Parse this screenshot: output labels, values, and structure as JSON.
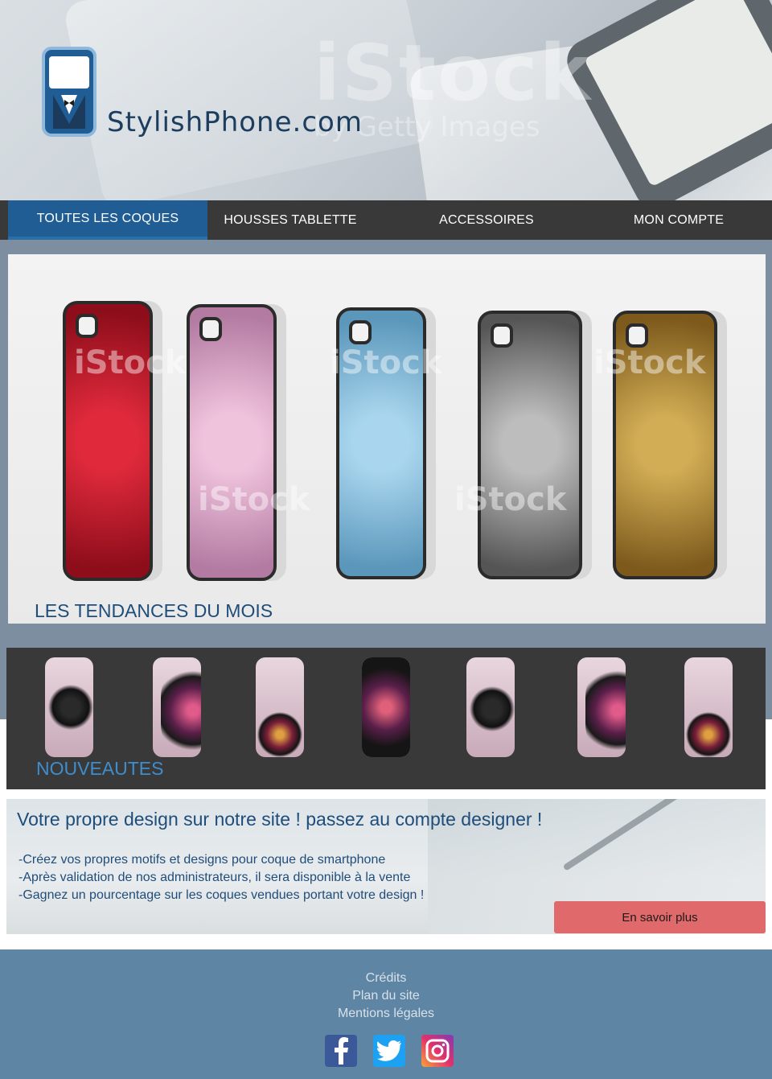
{
  "brand": {
    "name": "StylishPhone.com"
  },
  "header": {
    "watermark": "iStock",
    "watermark_sub": "by Getty Images"
  },
  "nav": {
    "items": [
      {
        "label": "TOUTES LES COQUES"
      },
      {
        "label": "HOUSSES TABLETTE"
      },
      {
        "label": "ACCESSOIRES"
      },
      {
        "label": "MON COMPTE"
      }
    ]
  },
  "hero": {
    "label": "LES TENDANCES DU MOIS",
    "watermark": "iStock",
    "case_colors": [
      "#c01728",
      "#d9a3c6",
      "#7fb8d8",
      "#8f8f8f",
      "#b08a3c"
    ]
  },
  "new": {
    "label": "NOUVEAUTES"
  },
  "designer": {
    "title": "Votre propre design sur notre site ! passez au compte designer !",
    "lines": [
      "-Créez vos propres motifs et designs pour coque de smartphone",
      "-Après validation de nos administrateurs, il sera disponible à la vente",
      "-Gagnez un pourcentage sur les coques vendues portant votre design !"
    ],
    "button_label": "En  savoir plus"
  },
  "footer": {
    "links": [
      "Crédits",
      "Plan du site",
      "Mentions légales"
    ],
    "social": [
      {
        "icon": "facebook-icon",
        "color": "#3b5998"
      },
      {
        "icon": "twitter-icon",
        "color": "#1da1f2"
      },
      {
        "icon": "instagram-icon",
        "color": "#c13584"
      }
    ]
  }
}
